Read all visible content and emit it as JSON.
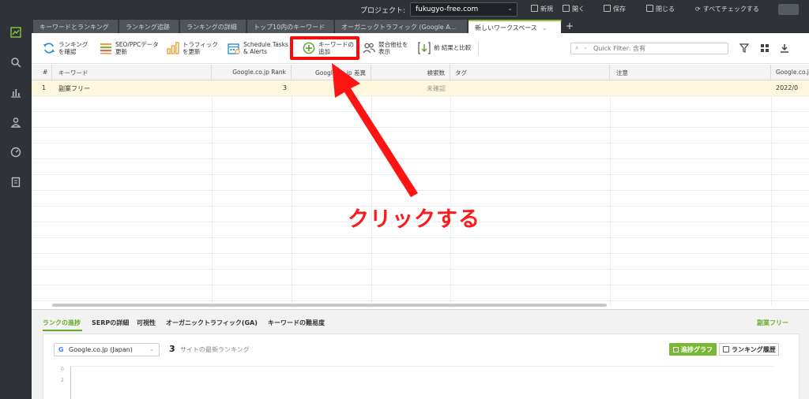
{
  "topbar": {
    "project_label": "プロジェクト:",
    "project_value": "fukugyo-free.com",
    "actions": [
      "新規",
      "開く",
      "保存",
      "閉じる",
      "すべてチェックする"
    ]
  },
  "tabs": [
    "キーワードとランキング",
    "ランキング追跡",
    "ランキングの詳細",
    "トップ10内のキーワード",
    "オーガニックトラフィック (Google A...",
    "新しいワークスペース"
  ],
  "toolbar": {
    "check_rank": "ランキング\nを確認",
    "seo_ppc": "SEO/PPCデータ\n更新",
    "traffic": "トラフィック\nを更新",
    "schedule": "Schedule Tasks\n& Alerts",
    "add_keyword": "キーワードの\n追加",
    "competitors": "競合他社を\n表示",
    "compare": "前 結果と比較",
    "quick_filter_placeholder": "Quick Filter: 含有"
  },
  "table": {
    "headers": [
      "#",
      "キーワード",
      "Google.co.jp Rank",
      "Google.co.jp 差異",
      "検索数",
      "タグ",
      "注意",
      "Google.co.jp"
    ],
    "rows": [
      {
        "num": "1",
        "keyword": "副業フリー",
        "rank": "3",
        "diff": "",
        "volume": "未確認",
        "tag": "",
        "note": "",
        "date": "2022/0"
      }
    ]
  },
  "bottom": {
    "tabs": [
      "ランクの進捗",
      "SERPの詳細",
      "可視性",
      "オーガニックトラフィック(GA)",
      "キーワードの難易度"
    ],
    "keyword": "副業フリー",
    "engine": "Google.co.jp (Japan)",
    "rank_value": "3",
    "rank_caption": "サイトの最新ランキング",
    "btn_progress": "進捗グラフ",
    "btn_history": "ランキング履歴",
    "chart_ticks": [
      "0",
      "2"
    ]
  },
  "annotation": {
    "text": "クリックする",
    "color": "#ff1a1a"
  },
  "colors": {
    "accent_green": "#8cc63f",
    "highlight_red": "#ff0a0a"
  }
}
